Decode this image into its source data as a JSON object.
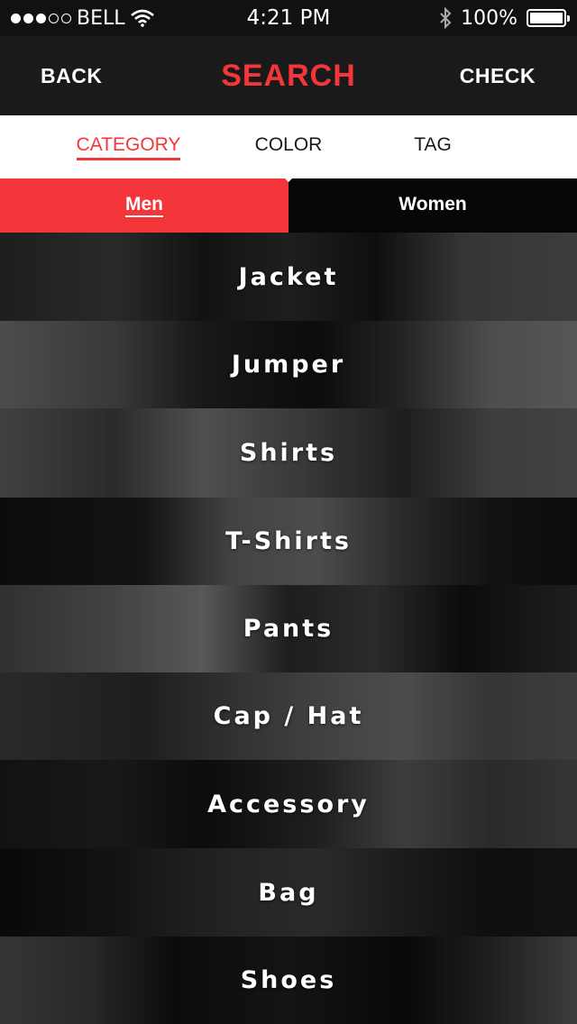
{
  "status_bar": {
    "carrier": "BELL",
    "time": "4:21 PM",
    "battery": "100%",
    "signal_icon": "signal-dots-icon",
    "wifi_icon": "wifi-icon",
    "bluetooth_icon": "bluetooth-icon",
    "battery_icon": "battery-icon"
  },
  "nav": {
    "back_label": "BACK",
    "title": "SEARCH",
    "check_label": "CHECK",
    "accent_color": "#f4363a"
  },
  "tabs": {
    "items": [
      {
        "label": "CATEGORY",
        "active": true
      },
      {
        "label": "COLOR",
        "active": false
      },
      {
        "label": "TAG",
        "active": false
      }
    ]
  },
  "gender": {
    "items": [
      {
        "label": "Men",
        "active": true
      },
      {
        "label": "Women",
        "active": false
      }
    ]
  },
  "categories": [
    {
      "label": "Jacket"
    },
    {
      "label": "Jumper"
    },
    {
      "label": "Shirts"
    },
    {
      "label": "T-Shirts"
    },
    {
      "label": "Pants"
    },
    {
      "label": "Cap / Hat"
    },
    {
      "label": "Accessory"
    },
    {
      "label": "Bag"
    },
    {
      "label": "Shoes"
    }
  ]
}
